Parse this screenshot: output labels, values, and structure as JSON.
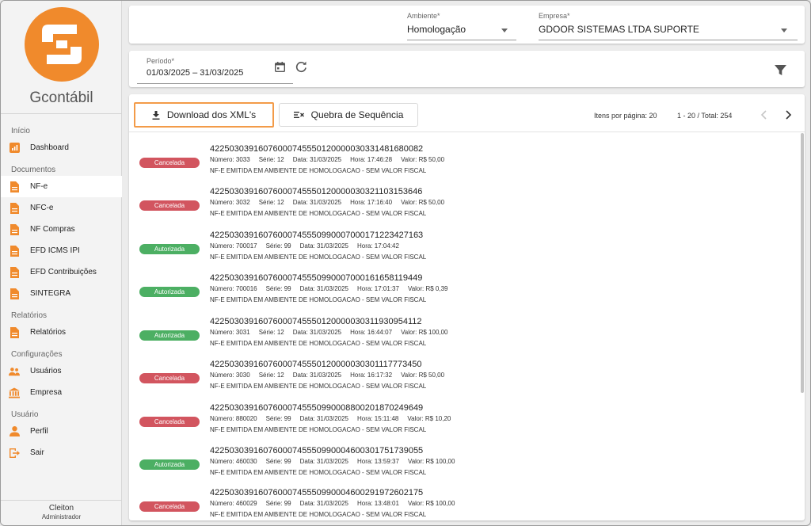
{
  "app": {
    "brand": "Gcontábil"
  },
  "colors": {
    "orange": "#f08a2c",
    "cancelada": "#d2555f",
    "autorizada": "#4caf63"
  },
  "sidebar": {
    "sections": [
      {
        "title": "Início",
        "items": [
          {
            "label": "Dashboard",
            "icon": "dashboard-icon"
          }
        ]
      },
      {
        "title": "Documentos",
        "items": [
          {
            "label": "NF-e",
            "icon": "document-icon"
          },
          {
            "label": "NFC-e",
            "icon": "document-icon"
          },
          {
            "label": "NF Compras",
            "icon": "document-icon"
          },
          {
            "label": "EFD ICMS IPI",
            "icon": "document-icon"
          },
          {
            "label": "EFD Contribuições",
            "icon": "document-icon"
          },
          {
            "label": "SINTEGRA",
            "icon": "document-icon"
          }
        ]
      },
      {
        "title": "Relatórios",
        "items": [
          {
            "label": "Relatórios",
            "icon": "document-icon"
          }
        ]
      },
      {
        "title": "Configurações",
        "items": [
          {
            "label": "Usuários",
            "icon": "users-icon"
          },
          {
            "label": "Empresa",
            "icon": "bank-icon"
          }
        ]
      },
      {
        "title": "Usuário",
        "items": [
          {
            "label": "Perfil",
            "icon": "person-icon"
          },
          {
            "label": "Sair",
            "icon": "logout-icon"
          }
        ]
      }
    ],
    "user": {
      "name": "Cleiton",
      "role": "Administrador"
    }
  },
  "header": {
    "ambiente": {
      "label": "Ambiente*",
      "value": "Homologação"
    },
    "empresa": {
      "label": "Empresa*",
      "value": "GDOOR SISTEMAS LTDA SUPORTE"
    }
  },
  "period": {
    "label": "Período*",
    "value": "01/03/2025 – 31/03/2025"
  },
  "toolbar": {
    "download_label": "Download dos XML's",
    "sequence_label": "Quebra de Sequência",
    "per_page": "Itens por página: 20",
    "range": "1 - 20 / Total: 254"
  },
  "note": "NF-E EMITIDA EM AMBIENTE DE HOMOLOGACAO - SEM VALOR FISCAL",
  "rows": [
    {
      "status": "Cancelada",
      "key": "42250303916076000745550120000030331481680082",
      "numero": "Número: 3033",
      "serie": "Série: 12",
      "data": "Data: 31/03/2025",
      "hora": "Hora: 17:46:28",
      "valor": "Valor: R$ 50,00"
    },
    {
      "status": "Cancelada",
      "key": "42250303916076000745550120000030321103153646",
      "numero": "Número: 3032",
      "serie": "Série: 12",
      "data": "Data: 31/03/2025",
      "hora": "Hora: 17:16:40",
      "valor": "Valor: R$ 50,00"
    },
    {
      "status": "Autorizada",
      "key": "42250303916076000745550990007000171223427163",
      "numero": "Número: 700017",
      "serie": "Série: 99",
      "data": "Data: 31/03/2025",
      "hora": "Hora: 17:04:42",
      "valor": ""
    },
    {
      "status": "Autorizada",
      "key": "42250303916076000745550990007000161658119449",
      "numero": "Número: 700016",
      "serie": "Série: 99",
      "data": "Data: 31/03/2025",
      "hora": "Hora: 17:01:37",
      "valor": "Valor: R$ 0,39"
    },
    {
      "status": "Autorizada",
      "key": "42250303916076000745550120000030311930954112",
      "numero": "Número: 3031",
      "serie": "Série: 12",
      "data": "Data: 31/03/2025",
      "hora": "Hora: 16:44:07",
      "valor": "Valor: R$ 100,00"
    },
    {
      "status": "Cancelada",
      "key": "42250303916076000745550120000030301117773450",
      "numero": "Número: 3030",
      "serie": "Série: 12",
      "data": "Data: 31/03/2025",
      "hora": "Hora: 16:17:32",
      "valor": "Valor: R$ 50,00"
    },
    {
      "status": "Cancelada",
      "key": "42250303916076000745550990008800201870249649",
      "numero": "Número: 880020",
      "serie": "Série: 99",
      "data": "Data: 31/03/2025",
      "hora": "Hora: 15:11:48",
      "valor": "Valor: R$ 10,20"
    },
    {
      "status": "Autorizada",
      "key": "42250303916076000745550990004600301751739055",
      "numero": "Número: 460030",
      "serie": "Série: 99",
      "data": "Data: 31/03/2025",
      "hora": "Hora: 13:59:37",
      "valor": "Valor: R$ 100,00"
    },
    {
      "status": "Cancelada",
      "key": "42250303916076000745550990004600291972602175",
      "numero": "Número: 460029",
      "serie": "Série: 99",
      "data": "Data: 31/03/2025",
      "hora": "Hora: 13:48:01",
      "valor": "Valor: R$ 100,00"
    }
  ]
}
